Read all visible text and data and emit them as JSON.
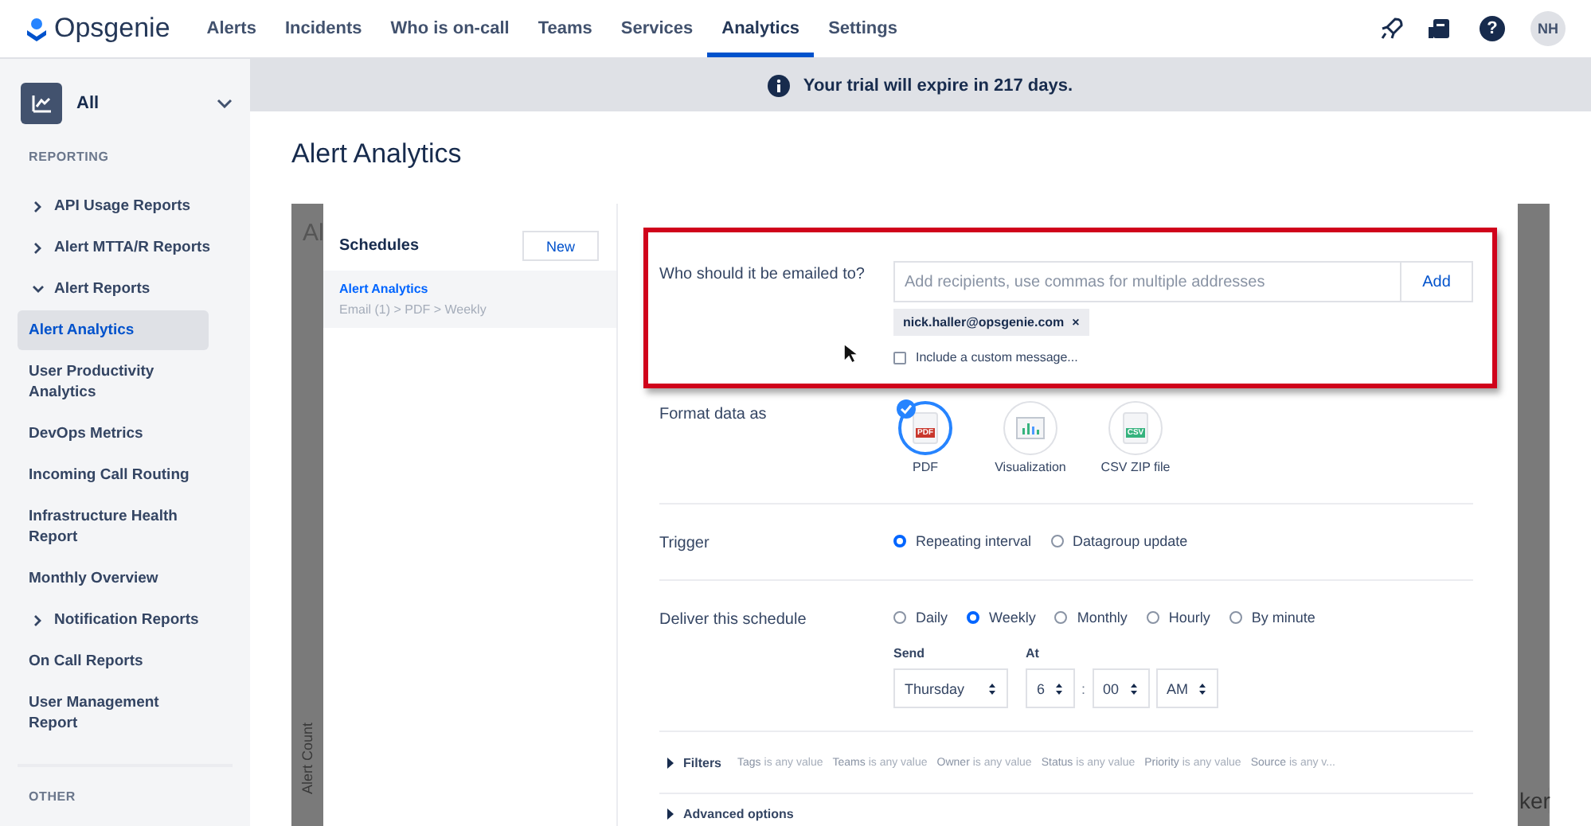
{
  "nav": {
    "logo": "Opsgenie",
    "items": [
      {
        "label": "Alerts",
        "selected": false
      },
      {
        "label": "Incidents",
        "selected": false
      },
      {
        "label": "Who is on-call",
        "selected": false
      },
      {
        "label": "Teams",
        "selected": false
      },
      {
        "label": "Services",
        "selected": false
      },
      {
        "label": "Analytics",
        "selected": true
      },
      {
        "label": "Settings",
        "selected": false
      }
    ],
    "help_glyph": "?",
    "avatar": "NH"
  },
  "banner": {
    "text": "Your trial will expire in 217 days."
  },
  "sidebar": {
    "selector": "All",
    "section_1": "REPORTING",
    "items": [
      {
        "label": "API Usage Reports",
        "kind": "group",
        "expanded": false,
        "selected": false
      },
      {
        "label": "Alert MTTA/R Reports",
        "kind": "group",
        "expanded": false,
        "selected": false
      },
      {
        "label": "Alert Reports",
        "kind": "group",
        "expanded": true,
        "selected": false
      },
      {
        "label": "Alert Analytics",
        "kind": "page",
        "selected": true
      },
      {
        "label": "User Productivity Analytics",
        "kind": "page",
        "selected": false
      },
      {
        "label": "DevOps Metrics",
        "kind": "page",
        "selected": false
      },
      {
        "label": "Incoming Call Routing",
        "kind": "page",
        "selected": false
      },
      {
        "label": "Infrastructure Health Report",
        "kind": "page",
        "selected": false
      },
      {
        "label": "Monthly Overview",
        "kind": "page",
        "selected": false
      },
      {
        "label": "Notification Reports",
        "kind": "group",
        "expanded": false,
        "selected": false
      },
      {
        "label": "On Call Reports",
        "kind": "page",
        "selected": false
      },
      {
        "label": "User Management Report",
        "kind": "page",
        "selected": false
      }
    ],
    "section_2": "OTHER"
  },
  "page_title": "Alert Analytics",
  "background_page": {
    "title_fragment": "Al",
    "axis_label": "Alert Count",
    "text_fragment": "ker"
  },
  "schedules": {
    "title": "Schedules",
    "new_button": "New",
    "items": [
      {
        "name": "Alert Analytics",
        "summary": "Email (1) > PDF > Weekly",
        "selected": true
      }
    ]
  },
  "form": {
    "email": {
      "highlighted": true,
      "label": "Who should it be emailed to?",
      "placeholder": "Add recipients, use commas for multiple addresses",
      "add_button": "Add",
      "recipients": [
        {
          "address": "nick.haller@opsgenie.com",
          "remove": "×"
        }
      ],
      "custom_message": {
        "label": "Include a custom message...",
        "checked": false
      }
    },
    "format": {
      "label": "Format data as",
      "options": [
        {
          "label": "PDF",
          "kind": "pdf",
          "badge": "PDF",
          "selected": true
        },
        {
          "label": "Visualization",
          "kind": "chart",
          "selected": false
        },
        {
          "label": "CSV ZIP file",
          "kind": "csv",
          "badge": "CSV",
          "selected": false
        }
      ]
    },
    "trigger": {
      "label": "Trigger",
      "options": [
        {
          "label": "Repeating interval",
          "selected": true
        },
        {
          "label": "Datagroup update",
          "selected": false
        }
      ]
    },
    "deliver": {
      "label": "Deliver this schedule",
      "options": [
        {
          "label": "Daily",
          "selected": false
        },
        {
          "label": "Weekly",
          "selected": true
        },
        {
          "label": "Monthly",
          "selected": false
        },
        {
          "label": "Hourly",
          "selected": false
        },
        {
          "label": "By minute",
          "selected": false
        }
      ],
      "send_label": "Send",
      "send_day": "Thursday",
      "at_label": "At",
      "hour": "6",
      "separator": ":",
      "minute": "00",
      "period": "AM"
    },
    "filters": {
      "label": "Filters",
      "expanded": false,
      "items": [
        {
          "field": "Tags",
          "condition": "is any value"
        },
        {
          "field": "Teams",
          "condition": "is any value"
        },
        {
          "field": "Owner",
          "condition": "is any value"
        },
        {
          "field": "Status",
          "condition": "is any value"
        },
        {
          "field": "Priority",
          "condition": "is any value"
        },
        {
          "field": "Source",
          "condition": "is any v..."
        }
      ]
    },
    "advanced": {
      "label": "Advanced options",
      "expanded": false
    }
  }
}
